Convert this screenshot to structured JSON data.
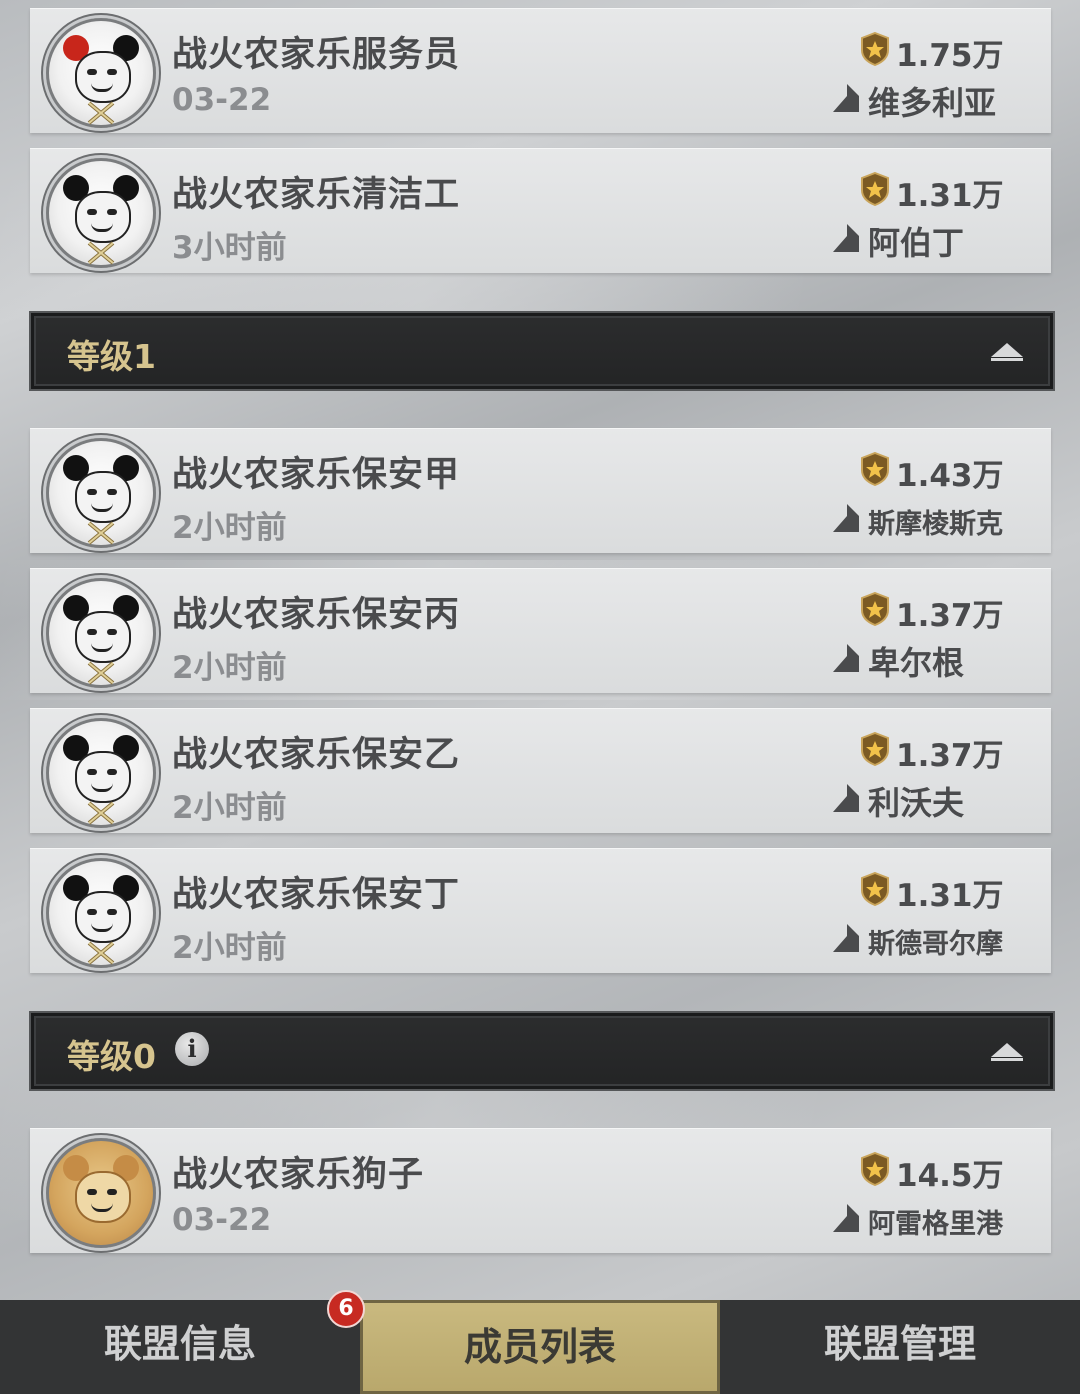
{
  "members_top": [
    {
      "name": "战火农家乐服务员",
      "time": "03-22",
      "power": "1.75万",
      "city": "维多利亚",
      "avatar": "crayfish-panda-avatar"
    },
    {
      "name": "战火农家乐清洁工",
      "time": "3小时前",
      "power": "1.31万",
      "city": "阿伯丁",
      "avatar": "cleaner-panda-avatar"
    }
  ],
  "group_level1": {
    "title": "等级1"
  },
  "members_level1": [
    {
      "name": "战火农家乐保安甲",
      "time": "2小时前",
      "power": "1.43万",
      "city": "斯摩棱斯克",
      "avatar": "guard-panda-avatar"
    },
    {
      "name": "战火农家乐保安丙",
      "time": "2小时前",
      "power": "1.37万",
      "city": "卑尔根",
      "avatar": "guard-panda-avatar"
    },
    {
      "name": "战火农家乐保安乙",
      "time": "2小时前",
      "power": "1.37万",
      "city": "利沃夫",
      "avatar": "guard-panda-avatar"
    },
    {
      "name": "战火农家乐保安丁",
      "time": "2小时前",
      "power": "1.31万",
      "city": "斯德哥尔摩",
      "avatar": "guard-panda-avatar"
    }
  ],
  "group_level0": {
    "title": "等级0",
    "info_icon": "info-icon"
  },
  "members_level0": [
    {
      "name": "战火农家乐狗子",
      "time": "03-22",
      "power": "14.5万",
      "city": "阿雷格里港",
      "avatar": "doge-avatar"
    }
  ],
  "tabs": [
    {
      "label": "联盟信息",
      "badge": "6"
    },
    {
      "label": "成员列表",
      "active": true
    },
    {
      "label": "联盟管理"
    }
  ],
  "colors": {
    "accent_gold": "#c9b97f",
    "group_bg": "#232425",
    "badge_red": "#c72a22"
  }
}
